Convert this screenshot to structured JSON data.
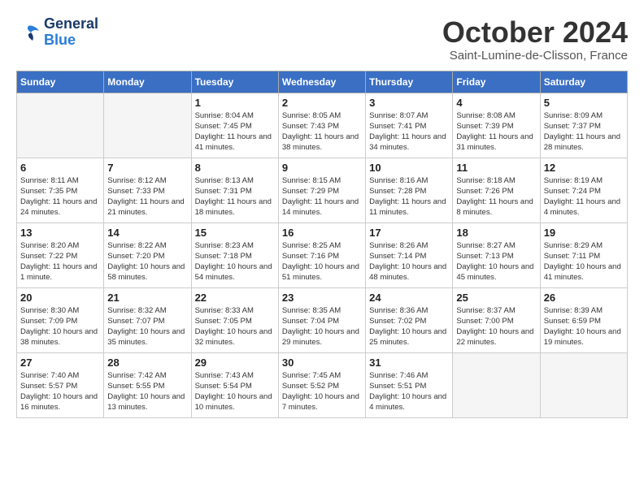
{
  "header": {
    "logo_general": "General",
    "logo_blue": "Blue",
    "month_title": "October 2024",
    "location": "Saint-Lumine-de-Clisson, France"
  },
  "weekdays": [
    "Sunday",
    "Monday",
    "Tuesday",
    "Wednesday",
    "Thursday",
    "Friday",
    "Saturday"
  ],
  "weeks": [
    [
      {
        "num": "",
        "info": ""
      },
      {
        "num": "",
        "info": ""
      },
      {
        "num": "1",
        "info": "Sunrise: 8:04 AM\nSunset: 7:45 PM\nDaylight: 11 hours and 41 minutes."
      },
      {
        "num": "2",
        "info": "Sunrise: 8:05 AM\nSunset: 7:43 PM\nDaylight: 11 hours and 38 minutes."
      },
      {
        "num": "3",
        "info": "Sunrise: 8:07 AM\nSunset: 7:41 PM\nDaylight: 11 hours and 34 minutes."
      },
      {
        "num": "4",
        "info": "Sunrise: 8:08 AM\nSunset: 7:39 PM\nDaylight: 11 hours and 31 minutes."
      },
      {
        "num": "5",
        "info": "Sunrise: 8:09 AM\nSunset: 7:37 PM\nDaylight: 11 hours and 28 minutes."
      }
    ],
    [
      {
        "num": "6",
        "info": "Sunrise: 8:11 AM\nSunset: 7:35 PM\nDaylight: 11 hours and 24 minutes."
      },
      {
        "num": "7",
        "info": "Sunrise: 8:12 AM\nSunset: 7:33 PM\nDaylight: 11 hours and 21 minutes."
      },
      {
        "num": "8",
        "info": "Sunrise: 8:13 AM\nSunset: 7:31 PM\nDaylight: 11 hours and 18 minutes."
      },
      {
        "num": "9",
        "info": "Sunrise: 8:15 AM\nSunset: 7:29 PM\nDaylight: 11 hours and 14 minutes."
      },
      {
        "num": "10",
        "info": "Sunrise: 8:16 AM\nSunset: 7:28 PM\nDaylight: 11 hours and 11 minutes."
      },
      {
        "num": "11",
        "info": "Sunrise: 8:18 AM\nSunset: 7:26 PM\nDaylight: 11 hours and 8 minutes."
      },
      {
        "num": "12",
        "info": "Sunrise: 8:19 AM\nSunset: 7:24 PM\nDaylight: 11 hours and 4 minutes."
      }
    ],
    [
      {
        "num": "13",
        "info": "Sunrise: 8:20 AM\nSunset: 7:22 PM\nDaylight: 11 hours and 1 minute."
      },
      {
        "num": "14",
        "info": "Sunrise: 8:22 AM\nSunset: 7:20 PM\nDaylight: 10 hours and 58 minutes."
      },
      {
        "num": "15",
        "info": "Sunrise: 8:23 AM\nSunset: 7:18 PM\nDaylight: 10 hours and 54 minutes."
      },
      {
        "num": "16",
        "info": "Sunrise: 8:25 AM\nSunset: 7:16 PM\nDaylight: 10 hours and 51 minutes."
      },
      {
        "num": "17",
        "info": "Sunrise: 8:26 AM\nSunset: 7:14 PM\nDaylight: 10 hours and 48 minutes."
      },
      {
        "num": "18",
        "info": "Sunrise: 8:27 AM\nSunset: 7:13 PM\nDaylight: 10 hours and 45 minutes."
      },
      {
        "num": "19",
        "info": "Sunrise: 8:29 AM\nSunset: 7:11 PM\nDaylight: 10 hours and 41 minutes."
      }
    ],
    [
      {
        "num": "20",
        "info": "Sunrise: 8:30 AM\nSunset: 7:09 PM\nDaylight: 10 hours and 38 minutes."
      },
      {
        "num": "21",
        "info": "Sunrise: 8:32 AM\nSunset: 7:07 PM\nDaylight: 10 hours and 35 minutes."
      },
      {
        "num": "22",
        "info": "Sunrise: 8:33 AM\nSunset: 7:05 PM\nDaylight: 10 hours and 32 minutes."
      },
      {
        "num": "23",
        "info": "Sunrise: 8:35 AM\nSunset: 7:04 PM\nDaylight: 10 hours and 29 minutes."
      },
      {
        "num": "24",
        "info": "Sunrise: 8:36 AM\nSunset: 7:02 PM\nDaylight: 10 hours and 25 minutes."
      },
      {
        "num": "25",
        "info": "Sunrise: 8:37 AM\nSunset: 7:00 PM\nDaylight: 10 hours and 22 minutes."
      },
      {
        "num": "26",
        "info": "Sunrise: 8:39 AM\nSunset: 6:59 PM\nDaylight: 10 hours and 19 minutes."
      }
    ],
    [
      {
        "num": "27",
        "info": "Sunrise: 7:40 AM\nSunset: 5:57 PM\nDaylight: 10 hours and 16 minutes."
      },
      {
        "num": "28",
        "info": "Sunrise: 7:42 AM\nSunset: 5:55 PM\nDaylight: 10 hours and 13 minutes."
      },
      {
        "num": "29",
        "info": "Sunrise: 7:43 AM\nSunset: 5:54 PM\nDaylight: 10 hours and 10 minutes."
      },
      {
        "num": "30",
        "info": "Sunrise: 7:45 AM\nSunset: 5:52 PM\nDaylight: 10 hours and 7 minutes."
      },
      {
        "num": "31",
        "info": "Sunrise: 7:46 AM\nSunset: 5:51 PM\nDaylight: 10 hours and 4 minutes."
      },
      {
        "num": "",
        "info": ""
      },
      {
        "num": "",
        "info": ""
      }
    ]
  ]
}
